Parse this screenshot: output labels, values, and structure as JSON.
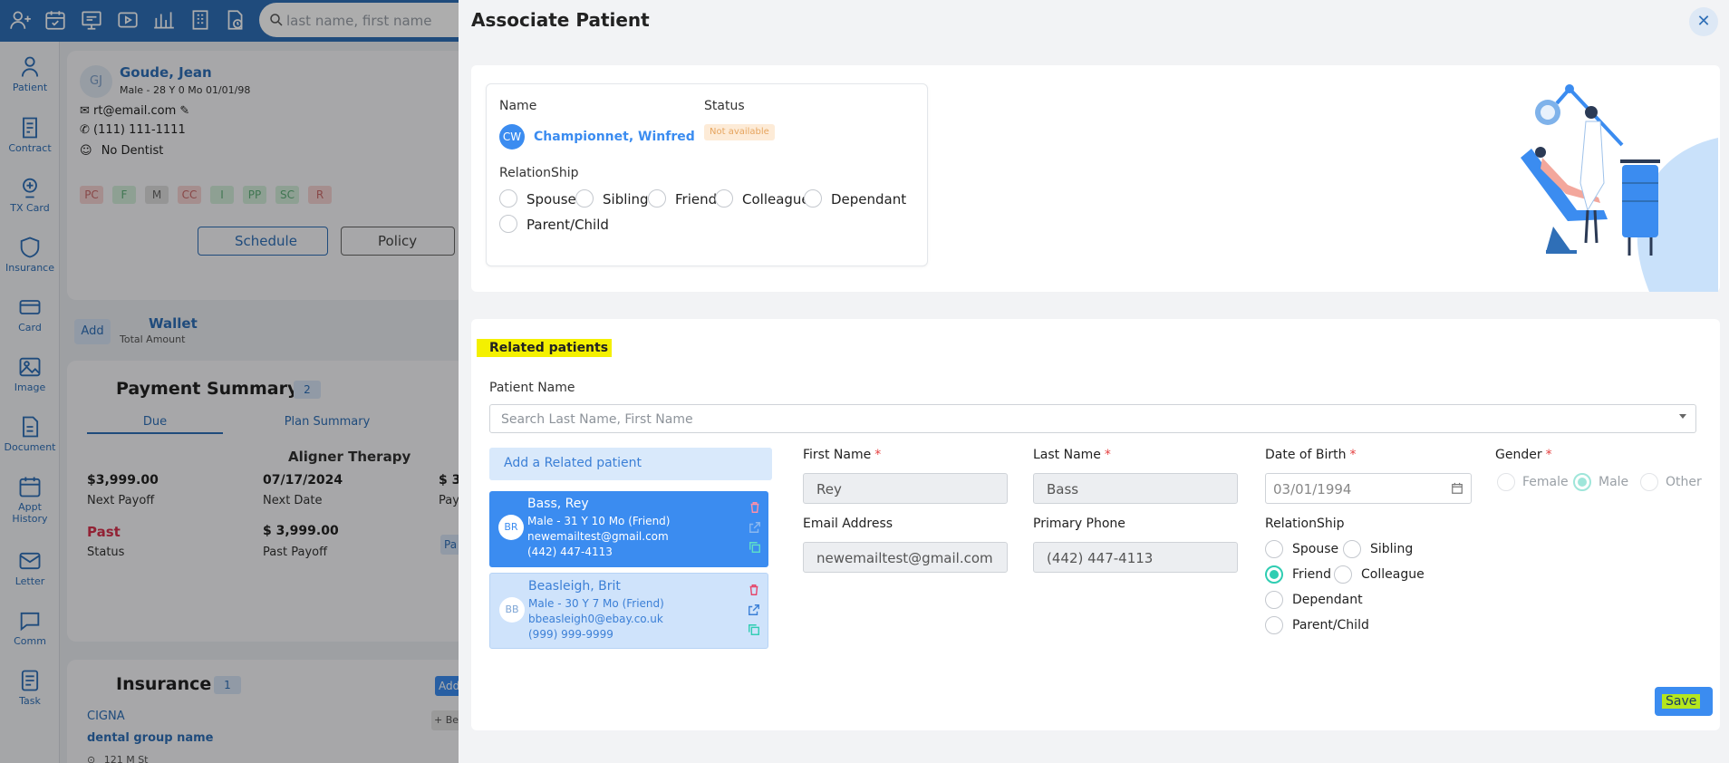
{
  "topbar": {
    "search_placeholder": "last name, first name",
    "icons": [
      "add-user-icon",
      "calendar-check-icon",
      "monitor-icon",
      "video-icon",
      "bar-chart-icon",
      "building-icon",
      "document-clock-icon",
      "search-icon"
    ]
  },
  "leftnav": {
    "items": [
      {
        "label": "Patient",
        "icon": "patient-icon"
      },
      {
        "label": "Contract",
        "icon": "contract-icon"
      },
      {
        "label": "TX Card",
        "icon": "tx-card-icon"
      },
      {
        "label": "Insurance",
        "icon": "insurance-icon"
      },
      {
        "label": "Card",
        "icon": "card-icon"
      },
      {
        "label": "Image",
        "icon": "image-icon"
      },
      {
        "label": "Document",
        "icon": "document-icon"
      },
      {
        "label": "Appt\nHistory",
        "icon": "appt-history-icon"
      },
      {
        "label": "Letter",
        "icon": "letter-icon"
      },
      {
        "label": "Comm",
        "icon": "comm-icon"
      },
      {
        "label": "Task",
        "icon": "task-icon"
      }
    ]
  },
  "background": {
    "patient": {
      "initials": "GJ",
      "name": "Goude, Jean",
      "meta": "Male - 28 Y 0 Mo 01/01/98",
      "email": "rt@email.com",
      "phone": "(111) 111-1111",
      "dentist": "No Dentist"
    },
    "tags": [
      "PC",
      "F",
      "M",
      "CC",
      "I",
      "PP",
      "SC",
      "R"
    ],
    "schedule_label": "Schedule",
    "policy_label": "Policy",
    "add_label": "Add",
    "wallet_title": "Wallet",
    "wallet_sub": "Total Amount",
    "payment_title": "Payment Summary",
    "payment_count": "2",
    "tab_due": "Due",
    "tab_plan": "Plan Summary",
    "plan_name": "Aligner Therapy",
    "amount1": "$3,999.00",
    "amount1_label": "Next Payoff",
    "date1": "07/17/2024",
    "date1_label": "Next Date",
    "amount_partial": "$ 3,",
    "amount_partial_label": "Pay",
    "past_label": "Past",
    "status_label": "Status",
    "amount2": "$ 3,999.00",
    "amount2_label": "Past Payoff",
    "pa_label": "Pa",
    "insurance_title": "Insurance",
    "insurance_count": "1",
    "ins_add": "Add",
    "ins_be": "+ Be",
    "insurer": "CIGNA",
    "group": "dental group name",
    "address": "121 M St"
  },
  "drawer": {
    "title": "Associate Patient",
    "current": {
      "name_label": "Name",
      "status_label": "Status",
      "initials": "CW",
      "name": "Championnet, Winfred",
      "status": "Not available",
      "relationship_label": "RelationShip",
      "options": [
        "Spouse",
        "Sibling",
        "Friend",
        "Colleague",
        "Dependant",
        "Parent/Child"
      ]
    },
    "related": {
      "section_title": "Related patients",
      "patient_name_label": "Patient Name",
      "search_placeholder": "Search Last Name, First Name",
      "add_related_label": "Add a Related patient",
      "cards": [
        {
          "initials": "BR",
          "name": "Bass, Rey",
          "meta": "Male - 31 Y 10 Mo (Friend)",
          "email": "newemailtest@gmail.com",
          "phone": "(442) 447-4113",
          "selected": true
        },
        {
          "initials": "BB",
          "name": "Beasleigh, Brit",
          "meta": "Male - 30 Y 7 Mo (Friend)",
          "email": "bbeasleigh0@ebay.co.uk",
          "phone": "(999) 999-9999",
          "selected": false
        }
      ],
      "form": {
        "first_name_label": "First Name",
        "first_name": "Rey",
        "last_name_label": "Last Name",
        "last_name": "Bass",
        "dob_label": "Date of Birth",
        "dob": "03/01/1994",
        "gender_label": "Gender",
        "gender_options": [
          "Female",
          "Male",
          "Other"
        ],
        "gender_selected": "Male",
        "email_label": "Email Address",
        "email": "newemailtest@gmail.com",
        "phone_label": "Primary Phone",
        "phone": "(442) 447-4113",
        "relationship_label": "RelationShip",
        "relationship_options": [
          "Spouse",
          "Sibling",
          "Friend",
          "Colleague",
          "Dependant",
          "Parent/Child"
        ],
        "relationship_selected": "Friend",
        "required_mark": "*"
      },
      "save_label": "Save"
    }
  },
  "colors": {
    "primary": "#2f6fb7",
    "accent_blue": "#3b8cf0",
    "teal": "#2fcdb2",
    "highlight": "#f4f000",
    "required": "#e43f3f"
  }
}
